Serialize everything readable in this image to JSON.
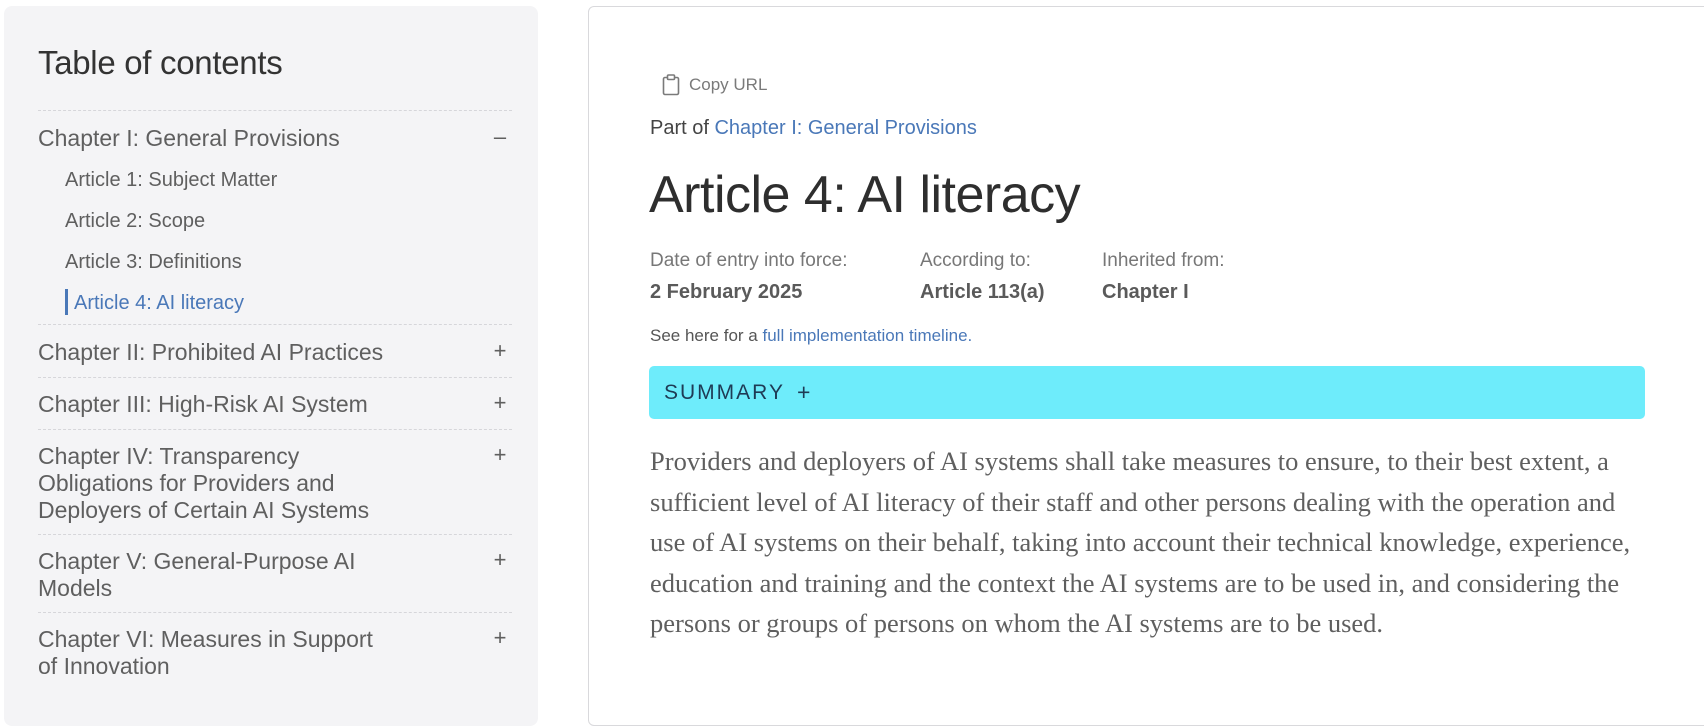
{
  "toc": {
    "title": "Table of contents",
    "chapters": [
      {
        "label": "Chapter I: General Provisions",
        "toggle": "–",
        "articles": [
          "Article 1: Subject Matter",
          "Article 2: Scope",
          "Article 3: Definitions",
          "Article 4: AI literacy"
        ]
      },
      {
        "label": "Chapter II: Prohibited AI Practices",
        "toggle": "+"
      },
      {
        "label": "Chapter III: High-Risk AI System",
        "toggle": "+"
      },
      {
        "label": "Chapter IV: Transparency Obligations for Providers and Deployers of Certain AI Systems",
        "toggle": "+"
      },
      {
        "label": "Chapter V: General-Purpose AI Models",
        "toggle": "+"
      },
      {
        "label": "Chapter VI: Measures in Support of Innovation",
        "toggle": "+"
      }
    ]
  },
  "main": {
    "copy_url": "Copy URL",
    "part_of_prefix": "Part of",
    "part_of_link": "Chapter I: General Provisions",
    "title": "Article 4: AI literacy",
    "meta": {
      "entry_label": "Date of entry into force:",
      "entry_value": "2 February 2025",
      "according_label": "According to:",
      "according_value": "Article 113(a)",
      "inherited_label": "Inherited from:",
      "inherited_value": "Chapter I"
    },
    "timeline_prefix": "See here for a",
    "timeline_link": "full implementation timeline.",
    "summary_label": "SUMMARY",
    "summary_toggle": "+",
    "body": "Providers and deployers of AI systems shall take measures to ensure, to their best extent, a sufficient level of AI literacy of their staff and other persons dealing with the operation and use of AI systems on their behalf, taking into account their technical knowledge, experience, education and training and the context the AI systems are to be used in, and considering the persons or groups of persons on whom the AI systems are to be used."
  },
  "icons": {
    "copy": "clipboard-icon"
  },
  "colors": {
    "accent": "#4a78b8",
    "summary_bg": "#6eecfb",
    "sidebar_bg": "#f4f4f6"
  }
}
